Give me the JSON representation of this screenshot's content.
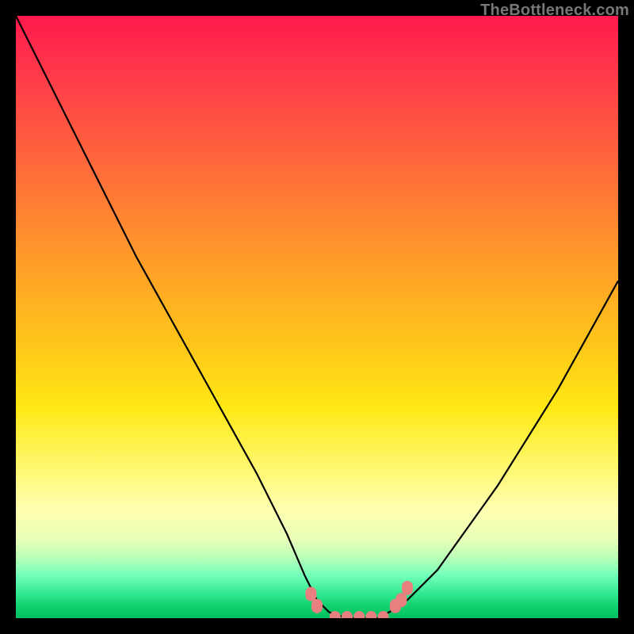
{
  "watermark": "TheBottleneck.com",
  "chart_data": {
    "type": "line",
    "title": "",
    "xlabel": "",
    "ylabel": "",
    "xlim": [
      0,
      100
    ],
    "ylim": [
      0,
      100
    ],
    "series": [
      {
        "name": "bottleneck-curve",
        "x": [
          0,
          5,
          10,
          15,
          20,
          25,
          30,
          35,
          40,
          45,
          48,
          50,
          52,
          55,
          57,
          60,
          62,
          65,
          70,
          75,
          80,
          85,
          90,
          95,
          100
        ],
        "y": [
          100,
          90,
          80,
          70,
          60,
          51,
          42,
          33,
          24,
          14,
          7,
          3,
          1,
          0,
          0,
          0,
          1,
          3,
          8,
          15,
          22,
          30,
          38,
          47,
          56
        ]
      }
    ],
    "markers": {
      "name": "valley-markers",
      "color": "#e88080",
      "points": [
        {
          "x": 49,
          "y": 4
        },
        {
          "x": 50,
          "y": 2
        },
        {
          "x": 53,
          "y": 0
        },
        {
          "x": 55,
          "y": 0
        },
        {
          "x": 57,
          "y": 0
        },
        {
          "x": 59,
          "y": 0
        },
        {
          "x": 61,
          "y": 0
        },
        {
          "x": 63,
          "y": 2
        },
        {
          "x": 64,
          "y": 3
        },
        {
          "x": 65,
          "y": 5
        }
      ]
    }
  }
}
